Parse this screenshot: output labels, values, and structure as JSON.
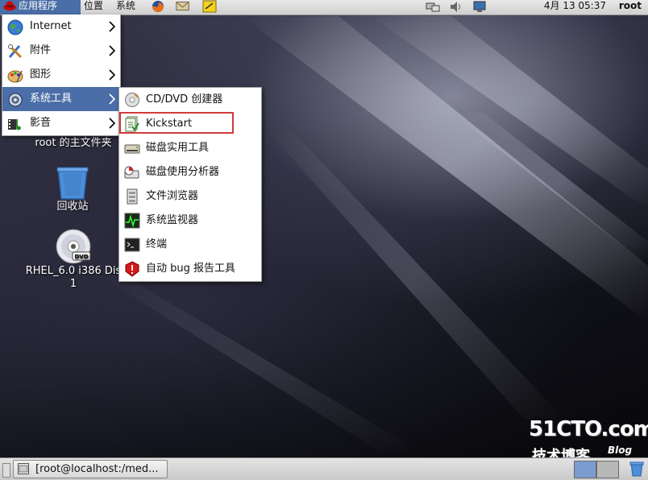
{
  "top_panel": {
    "apps_label": "应用程序",
    "places_label": "位置",
    "system_label": "系统",
    "clock": "4月 13 05:37",
    "user": "root"
  },
  "apps_menu": {
    "items": [
      {
        "label": "Internet",
        "icon": "globe-icon"
      },
      {
        "label": "附件",
        "icon": "accessories-icon"
      },
      {
        "label": "图形",
        "icon": "graphics-icon"
      },
      {
        "label": "系统工具",
        "icon": "system-tools-icon",
        "active": true
      },
      {
        "label": "影音",
        "icon": "multimedia-icon"
      }
    ]
  },
  "system_tools_submenu": {
    "items": [
      {
        "label": "CD/DVD 创建器",
        "icon": "cd-burner-icon"
      },
      {
        "label": "Kickstart",
        "icon": "kickstart-icon",
        "highlighted": true
      },
      {
        "label": "磁盘实用工具",
        "icon": "disk-utility-icon"
      },
      {
        "label": "磁盘使用分析器",
        "icon": "disk-analyzer-icon"
      },
      {
        "label": "文件浏览器",
        "icon": "file-browser-icon"
      },
      {
        "label": "系统监视器",
        "icon": "system-monitor-icon"
      },
      {
        "label": "终端",
        "icon": "terminal-icon"
      },
      {
        "label": "自动 bug 报告工具",
        "icon": "bug-report-icon"
      }
    ]
  },
  "desktop": {
    "home_label": "root 的主文件夹",
    "trash_label": "回收站",
    "dvd_label_line1": "RHEL_6.0 i386 Dis",
    "dvd_label_line2": "1",
    "dvd_badge": "DVD"
  },
  "watermark": {
    "logo": "51CTO.com",
    "subtitle": "技术博客",
    "blog": "Blog"
  },
  "taskbar": {
    "window_label": "[root@localhost:/med..."
  },
  "colors": {
    "menu_highlight": "#4b6ea8",
    "kickstart_outline": "#d23a3a"
  }
}
